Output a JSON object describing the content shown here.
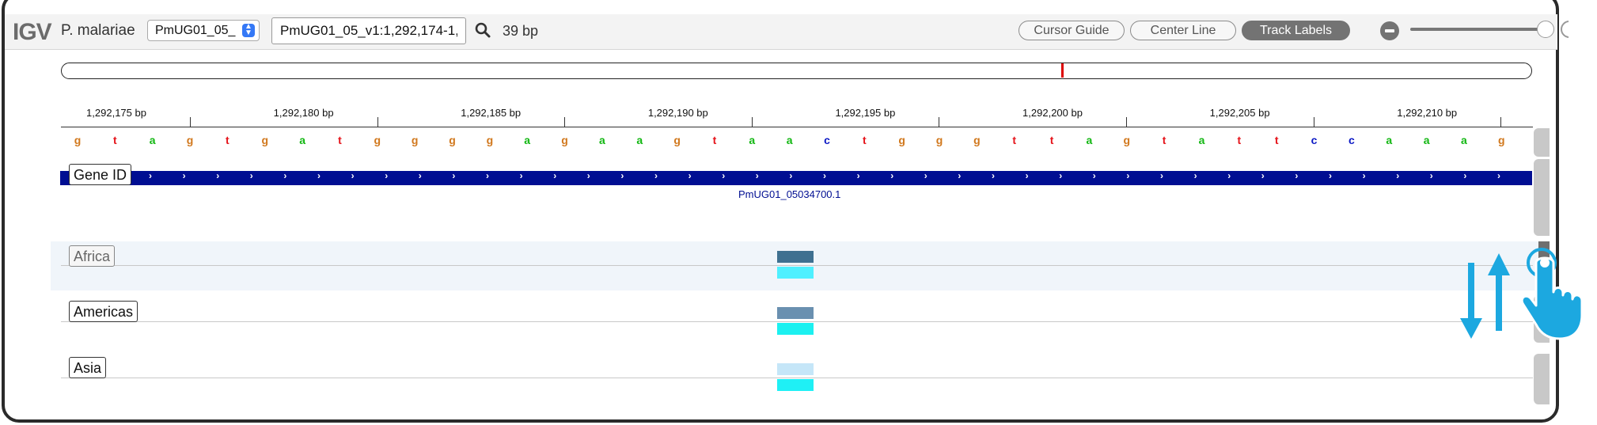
{
  "app": {
    "logo": "IGV"
  },
  "toolbar": {
    "genome": "P. malariae",
    "chromosome": "PmUG01_05_",
    "locus": "PmUG01_05_v1:1,292,174-1,",
    "width_label": "39 bp",
    "cursor_guide_label": "Cursor Guide",
    "center_line_label": "Center Line",
    "track_labels_label": "Track Labels",
    "zoom_level": 1.0
  },
  "ideogram": {
    "marker_fraction": 0.68
  },
  "ruler": {
    "ticks": [
      "1,292,175 bp",
      "1,292,180 bp",
      "1,292,185 bp",
      "1,292,190 bp",
      "1,292,195 bp",
      "1,292,200 bp",
      "1,292,205 bp",
      "1,292,210 bp"
    ]
  },
  "sequence": {
    "bases": [
      "g",
      "t",
      "a",
      "g",
      "t",
      "g",
      "a",
      "t",
      "g",
      "g",
      "g",
      "g",
      "a",
      "g",
      "a",
      "a",
      "g",
      "t",
      "a",
      "a",
      "c",
      "t",
      "g",
      "g",
      "g",
      "t",
      "t",
      "a",
      "g",
      "t",
      "a",
      "t",
      "t",
      "c",
      "c",
      "a",
      "a",
      "a",
      "g"
    ],
    "colors": {
      "a": "#12b712",
      "c": "#0a17c4",
      "g": "#d1781d",
      "t": "#e5131a"
    }
  },
  "gene_track": {
    "label": "Gene ID",
    "feature_name": "PmUG01_05034700.1",
    "color": "#000e92",
    "strand": "+"
  },
  "tracks": [
    {
      "label": "Africa",
      "top_color": "#3f7090",
      "bottom_color": "#4ff0ff",
      "highlighted": true
    },
    {
      "label": "Americas",
      "top_color": "#6a90b0",
      "bottom_color": "#1cf0f0",
      "highlighted": false
    },
    {
      "label": "Asia",
      "top_color": "#c5e6f8",
      "bottom_color": "#1ff0f5",
      "highlighted": false
    }
  ],
  "gesture": {
    "icon": "drag-reorder-hand-icon",
    "color": "#1ca8e0"
  }
}
